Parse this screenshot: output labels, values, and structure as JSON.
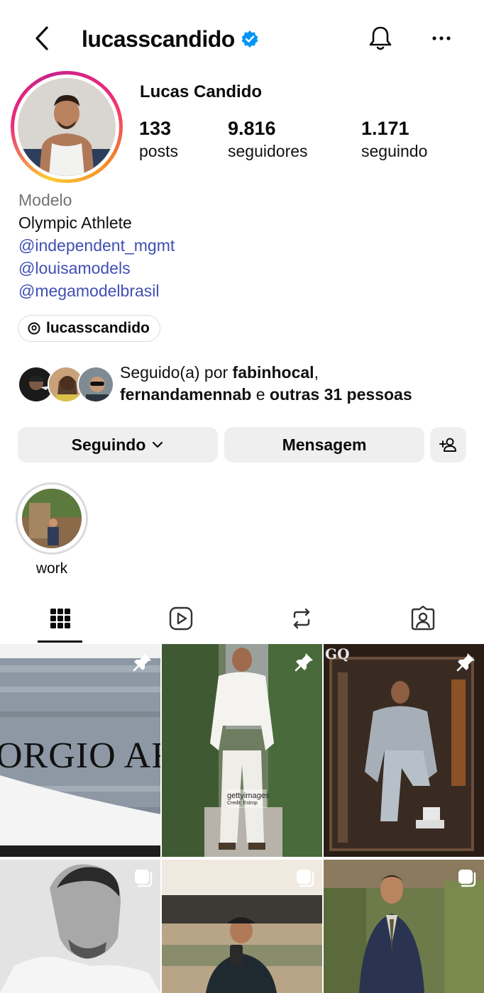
{
  "header": {
    "username": "lucasscandido"
  },
  "profile": {
    "full_name": "Lucas Candido",
    "stats": [
      {
        "value": "133",
        "label": "posts"
      },
      {
        "value": "9.816",
        "label": "seguidores"
      },
      {
        "value": "1.171",
        "label": "seguindo"
      }
    ],
    "category": "Modelo",
    "bio_line": "Olympic Athlete",
    "links": [
      "@independent_mgmt",
      "@louisamodels",
      "@megamodelbrasil"
    ],
    "threads_handle": "lucasscandido"
  },
  "followed_by": {
    "prefix": "Seguido(a) por ",
    "first": "fabinhocal",
    "comma": ",",
    "second": "fernandamennab",
    "conj": " e ",
    "others": "outras 31 pessoas"
  },
  "actions": {
    "following_label": "Seguindo",
    "message_label": "Mensagem"
  },
  "highlights": [
    {
      "label": "work"
    }
  ],
  "tabs": [
    {
      "icon": "grid-icon",
      "active": true
    },
    {
      "icon": "reels-icon",
      "active": false
    },
    {
      "icon": "repost-icon",
      "active": false
    },
    {
      "icon": "tagged-icon",
      "active": false
    }
  ],
  "posts": [
    {
      "text": "ORGIO ARM",
      "badge": "pin-icon"
    },
    {
      "text": "gettyimages",
      "subtext": "Credit: Estrop",
      "badge": "pin-icon"
    },
    {
      "text": "GQ",
      "badge": "pin-icon"
    },
    {
      "badge": "carousel-icon"
    },
    {
      "badge": "carousel-icon"
    },
    {
      "badge": "carousel-icon"
    }
  ],
  "colors": {
    "link": "#3f4fb3",
    "verified": "#0095f6",
    "button_bg": "#efefef"
  }
}
